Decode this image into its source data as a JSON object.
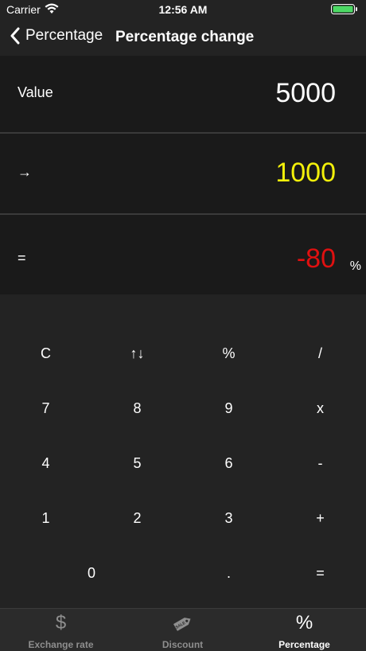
{
  "status": {
    "carrier": "Carrier",
    "time": "12:56 AM"
  },
  "nav": {
    "back_label": "Percentage",
    "title": "Percentage change"
  },
  "rows": {
    "value": {
      "label": "Value",
      "value": "5000",
      "color": "#ffffff"
    },
    "arrow": {
      "label": "→",
      "value": "1000",
      "color": "#f3f00a"
    },
    "result": {
      "label": "=",
      "value": "-80",
      "suffix": "%",
      "color": "#e01010"
    }
  },
  "keypad": {
    "row1": [
      "C",
      "↑↓",
      "%",
      "/"
    ],
    "row2": [
      "7",
      "8",
      "9",
      "x"
    ],
    "row3": [
      "4",
      "5",
      "6",
      "-"
    ],
    "row4": [
      "1",
      "2",
      "3",
      "+"
    ],
    "row5": [
      "0",
      ".",
      "="
    ]
  },
  "tabs": [
    {
      "label": "Exchange rate",
      "icon": "dollar-icon",
      "glyph": "$",
      "active": false
    },
    {
      "label": "Discount",
      "icon": "sale-tag-icon",
      "glyph": "",
      "active": false
    },
    {
      "label": "Percentage",
      "icon": "percent-icon",
      "glyph": "%",
      "active": true
    }
  ],
  "colors": {
    "tab_inactive": "#8e8e8e",
    "tab_active": "#ffffff"
  }
}
